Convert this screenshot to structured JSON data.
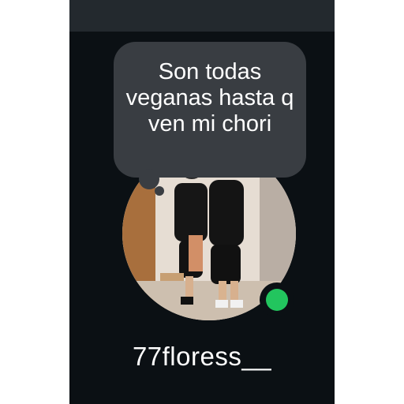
{
  "note": {
    "text": "Son todas veganas hasta q ven mi chori"
  },
  "profile": {
    "username": "77floress__",
    "online_status_color": "#22c55e",
    "avatar_description_icon": "profile-photo"
  },
  "colors": {
    "background": "#0b1014",
    "top_bar": "#23292e",
    "bubble": "#393d42",
    "text": "#ffffff"
  }
}
